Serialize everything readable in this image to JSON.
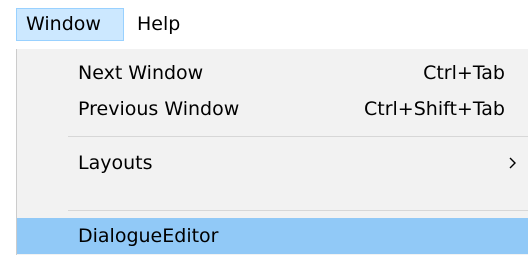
{
  "menubar": {
    "items": [
      {
        "label": "Window"
      },
      {
        "label": "Help"
      }
    ]
  },
  "dropdown": {
    "items": [
      {
        "label": "Next Window",
        "shortcut": "Ctrl+Tab"
      },
      {
        "label": "Previous Window",
        "shortcut": "Ctrl+Shift+Tab"
      },
      {
        "label": "Layouts",
        "submenu_icon": "chevron-right-icon"
      },
      {
        "label": "DialogueEditor"
      }
    ]
  },
  "colors": {
    "menubar_active_bg": "#cce8ff",
    "menubar_active_border": "#99d1ff",
    "dropdown_bg": "#f2f2f2",
    "selected_item_bg": "#91c9f7",
    "separator": "#d7d7d7"
  }
}
